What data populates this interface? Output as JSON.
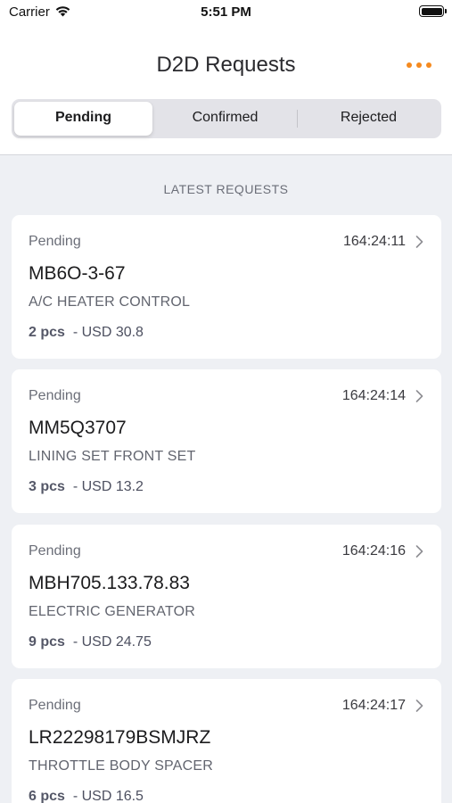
{
  "status_bar": {
    "carrier": "Carrier",
    "time": "5:51 PM"
  },
  "nav": {
    "title": "D2D Requests",
    "more_icon": "ellipsis-icon",
    "accent_color": "#f58a1f"
  },
  "tabs": [
    {
      "label": "Pending",
      "selected": true
    },
    {
      "label": "Confirmed",
      "selected": false
    },
    {
      "label": "Rejected",
      "selected": false
    }
  ],
  "section_header": "LATEST REQUESTS",
  "requests": [
    {
      "status": "Pending",
      "time": "164:24:11",
      "code": "MB6O-3-67",
      "description": "A/C HEATER CONTROL",
      "qty": "2 pcs",
      "price": "- USD 30.8"
    },
    {
      "status": "Pending",
      "time": "164:24:14",
      "code": "MM5Q3707",
      "description": "LINING SET FRONT SET",
      "qty": "3 pcs",
      "price": "- USD 13.2"
    },
    {
      "status": "Pending",
      "time": "164:24:16",
      "code": "MBH705.133.78.83",
      "description": "ELECTRIC GENERATOR",
      "qty": "9 pcs",
      "price": "- USD 24.75"
    },
    {
      "status": "Pending",
      "time": "164:24:17",
      "code": "LR22298179BSMJRZ",
      "description": "THROTTLE BODY SPACER",
      "qty": "6 pcs",
      "price": "- USD 16.5"
    }
  ]
}
